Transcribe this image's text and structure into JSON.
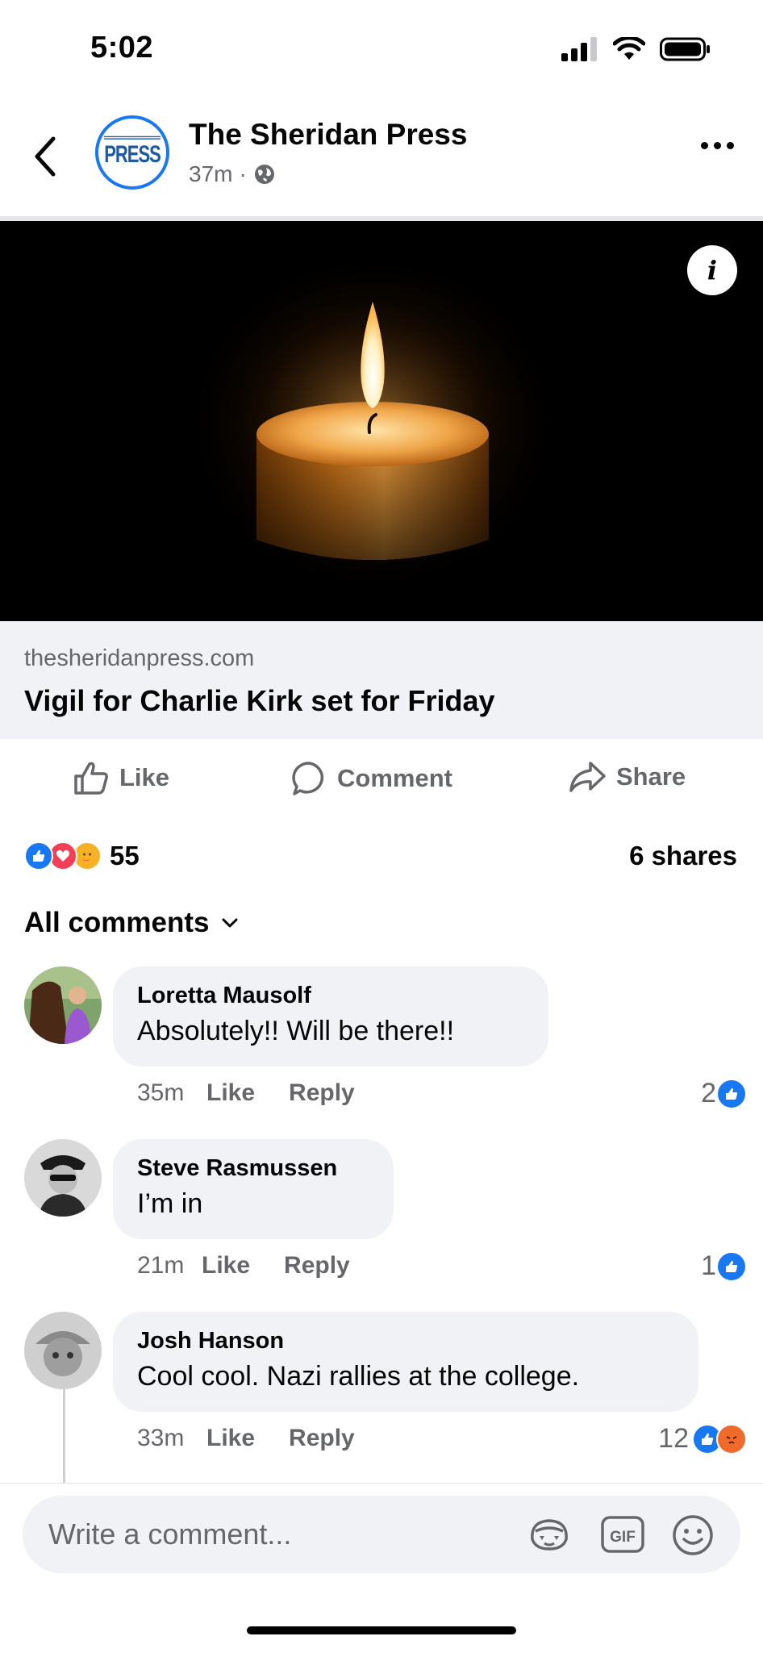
{
  "status_bar": {
    "time": "5:02"
  },
  "header": {
    "back_icon": "chevron-left-icon",
    "page_name": "The Sheridan Press",
    "avatar_text": "PRESS",
    "timestamp": "37m",
    "separator": "·",
    "audience_icon": "globe-icon",
    "more_icon": "more-horizontal-icon"
  },
  "post": {
    "image_subject": "lit-candle",
    "link_domain": "thesheridanpress.com",
    "link_title": "Vigil for Charlie Kirk set for Friday",
    "actions": {
      "like": "Like",
      "comment": "Comment",
      "share": "Share"
    },
    "reaction_types": [
      "like",
      "love",
      "care"
    ],
    "reaction_count": "55",
    "shares": "6 shares"
  },
  "comments_header": {
    "label": "All comments"
  },
  "comments": [
    {
      "name": "Loretta Mausolf",
      "text": "Absolutely!! Will be there!!",
      "time": "35m",
      "like": "Like",
      "reply": "Reply",
      "reaction_count": "2"
    },
    {
      "name": "Steve Rasmussen",
      "text": "I’m in",
      "time": "21m",
      "like": "Like",
      "reply": "Reply",
      "reaction_count": "1"
    },
    {
      "name": "Josh Hanson",
      "text": "Cool cool. Nazi rallies at the college.",
      "time": "33m",
      "like": "Like",
      "reply": "Reply",
      "reaction_count": "12"
    }
  ],
  "composer": {
    "placeholder": "Write a comment...",
    "avatar_icon": "avatar-sticker-icon",
    "gif_label": "GIF",
    "emoji_icon": "emoji-icon"
  },
  "colors": {
    "accent": "#1877f2",
    "secondary_text": "#65676b",
    "bubble": "#f0f2f5"
  }
}
